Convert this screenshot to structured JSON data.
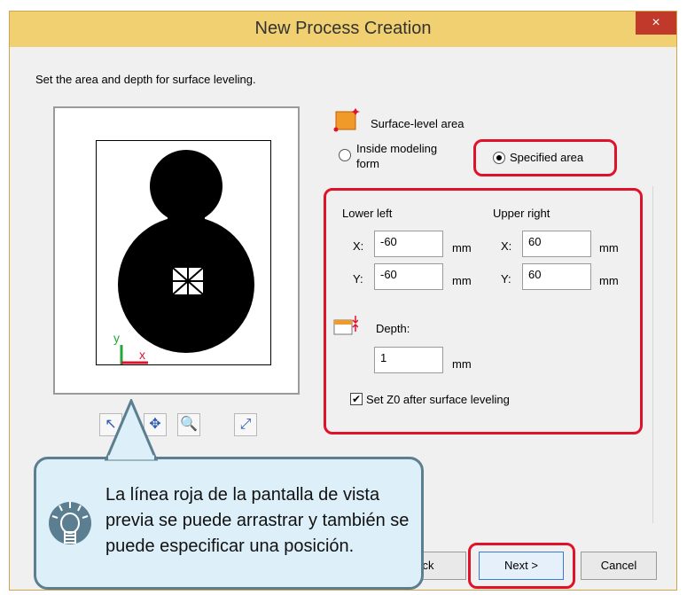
{
  "window": {
    "title": "New Process Creation",
    "close_symbol": "×",
    "instruction": "Set the area and depth for surface leveling."
  },
  "surface_area": {
    "label": "Surface-level area",
    "inside_modeling_form_line1": "Inside modeling",
    "inside_modeling_form_line2": "form",
    "specified_area": "Specified area"
  },
  "coordinates": {
    "lower_left_label": "Lower left",
    "upper_right_label": "Upper right",
    "x_label": "X:",
    "y_label": "Y:",
    "unit": "mm",
    "lower_left_x": "-60",
    "lower_left_y": "-60",
    "upper_right_x": "60",
    "upper_right_y": "60"
  },
  "depth": {
    "label": "Depth:",
    "value": "1",
    "unit": "mm"
  },
  "set_z0": {
    "checked_symbol": "✔",
    "label": "Set Z0 after surface leveling"
  },
  "preview": {
    "axis_y": "y",
    "axis_x": "x"
  },
  "buttons": {
    "back_label": "ck",
    "next_label": "Next >",
    "cancel_label": "Cancel"
  },
  "callout": {
    "text": "La línea roja de la pantalla de vista previa se puede arrastrar y también se puede especificar una posición."
  },
  "colors": {
    "highlight": "#e0122a",
    "titlebar": "#f0d070",
    "callout_bg": "#ddeff8",
    "callout_border": "#5b7f91",
    "icon_orange": "#f09a2a"
  }
}
